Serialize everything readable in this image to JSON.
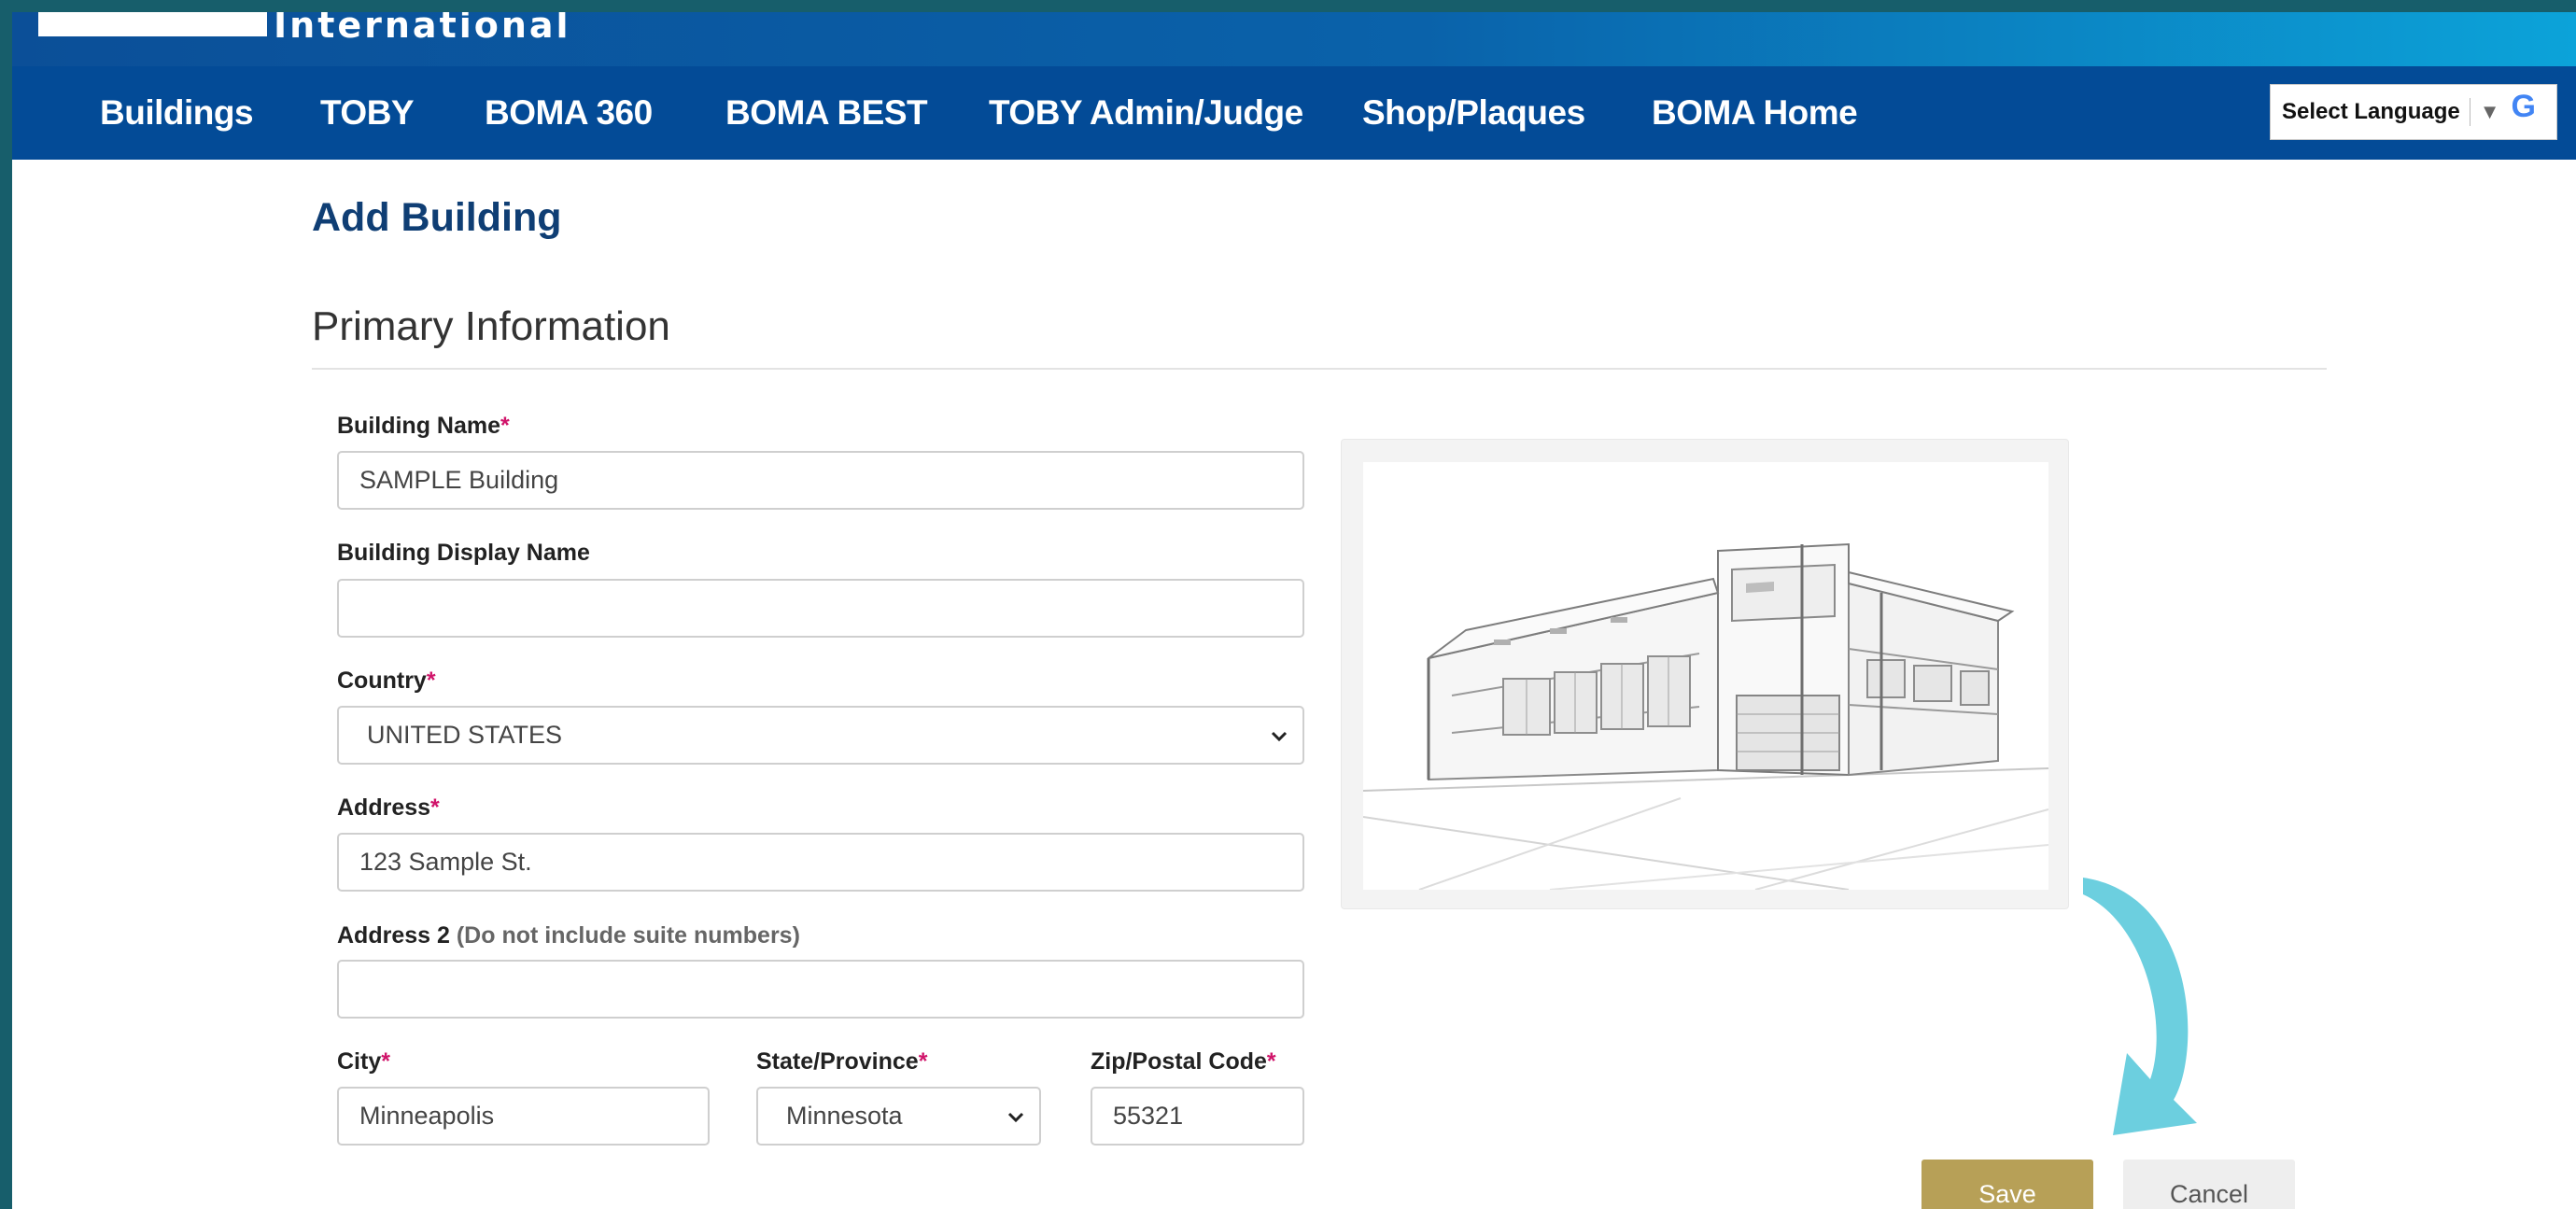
{
  "app": {
    "brand": "International"
  },
  "nav": {
    "items": [
      "Buildings",
      "TOBY",
      "BOMA 360",
      "BOMA BEST",
      "TOBY Admin/Judge",
      "Shop/Plaques",
      "BOMA Home"
    ],
    "language_label": "Select Language",
    "language_caret": "▼",
    "google_glyph": "G"
  },
  "page": {
    "title": "Add Building",
    "section_title": "Primary Information"
  },
  "form": {
    "building_name": {
      "label": "Building Name",
      "required_mark": "*",
      "value": "SAMPLE Building"
    },
    "display_name": {
      "label": "Building Display Name",
      "value": ""
    },
    "country": {
      "label": "Country",
      "required_mark": "*",
      "value": "UNITED STATES"
    },
    "address": {
      "label": "Address",
      "required_mark": "*",
      "value": "123 Sample St."
    },
    "address2": {
      "label": "Address 2",
      "hint": "(Do not include suite numbers)",
      "value": ""
    },
    "city": {
      "label": "City",
      "required_mark": "*",
      "value": "Minneapolis"
    },
    "state": {
      "label": "State/Province",
      "required_mark": "*",
      "value": "Minnesota"
    },
    "zip": {
      "label": "Zip/Postal Code",
      "required_mark": "*",
      "value": "55321"
    }
  },
  "actions": {
    "save_label": "Save",
    "cancel_label": "Cancel"
  },
  "colors": {
    "nav_bg": "#034b97",
    "title": "#0f3e74",
    "required": "#d0146a",
    "save_bg": "#b7a057",
    "arrow": "#6ccfdf",
    "outer_bg": "#175e6b"
  },
  "icons": {
    "select_chevron": "chevron-down-icon",
    "google": "google-g-icon",
    "arrow": "curved-arrow-icon"
  }
}
